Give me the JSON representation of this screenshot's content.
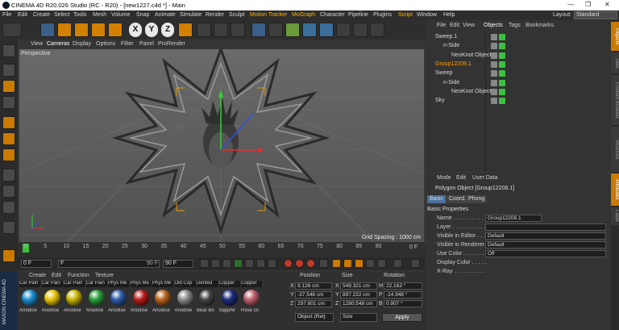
{
  "window": {
    "title": "CINEMA 4D R20.026 Studio (RC - R20) - [new1227.c4d *] - Main",
    "min": "—",
    "max": "❐",
    "close": "✕"
  },
  "menu": [
    "File",
    "Edit",
    "Create",
    "Select",
    "Tools",
    "Mesh",
    "Volume",
    "Snap",
    "Animate",
    "Simulate",
    "Render",
    "Sculpt",
    "Motion Tracker",
    "MoGraph",
    "Character",
    "Pipeline",
    "Plugins",
    "Script",
    "Window",
    "Help"
  ],
  "layout": {
    "label": "Layout:",
    "value": "Standard"
  },
  "toolbar": {
    "axes": [
      "X",
      "Y",
      "Z"
    ]
  },
  "viewport": {
    "menu": [
      "View",
      "Cameras",
      "Display",
      "Options",
      "Filter",
      "Panel",
      "ProRender"
    ],
    "label": "Perspective",
    "grid_spacing": "Grid Spacing : 1000 cm"
  },
  "timeline": {
    "ticks": [
      "0",
      "5",
      "10",
      "15",
      "20",
      "25",
      "30",
      "35",
      "40",
      "45",
      "50",
      "55",
      "60",
      "65",
      "70",
      "75",
      "80",
      "85",
      "90"
    ],
    "end": "0 F",
    "start_field": "0 F",
    "range_start": "F",
    "range_end": "90 F",
    "range_max": "90 F"
  },
  "materials": {
    "menu": [
      "Create",
      "Edit",
      "Function",
      "Texture"
    ],
    "items": [
      {
        "name": "Car Pain",
        "label": "Anodise",
        "color": "#1c8fd0"
      },
      {
        "name": "Car Pain",
        "label": "Anodise",
        "color": "#e8c400"
      },
      {
        "name": "Car Pain",
        "label": "Anodise",
        "color": "#c8b400"
      },
      {
        "name": "Car Pain",
        "label": "Anodise",
        "color": "#2a9d3a"
      },
      {
        "name": "Phys Me",
        "label": "Anodise",
        "color": "#2f5ca8"
      },
      {
        "name": "Phys Me",
        "label": "Anodise",
        "color": "#b71c1c"
      },
      {
        "name": "Phys Me",
        "label": "Anodise",
        "color": "#b8651c"
      },
      {
        "name": "Old Cop",
        "label": "Anodise",
        "color": "#8a8a8a"
      },
      {
        "name": "Dented",
        "label": "Bear Bo",
        "color": "#444444"
      },
      {
        "name": "Copper",
        "label": "Sapphir",
        "color": "#1d2b7a"
      },
      {
        "name": "Copper",
        "label": "Rose Gl",
        "color": "#c06070"
      }
    ]
  },
  "coords": {
    "headers": [
      "Position",
      "Size",
      "Rotation"
    ],
    "rows": [
      {
        "axis": "X",
        "pos": "9.126 cm",
        "size": "549.321 cm",
        "rot_axis": "H",
        "rot": "22.163 °"
      },
      {
        "axis": "Y",
        "pos": "-37.548 cm",
        "size": "897.222 cm",
        "rot_axis": "P",
        "rot": "-14.948 °"
      },
      {
        "axis": "Z",
        "pos": "297.601 cm",
        "size": "1280.548 cm",
        "rot_axis": "B",
        "rot": "0.907 °"
      }
    ],
    "mode1": "Object (Rel)",
    "mode2": "Size",
    "apply": "Apply"
  },
  "objects": {
    "tabs": [
      "File",
      "Edit",
      "View",
      "Objects",
      "Tags",
      "Bookmarks"
    ],
    "items": [
      {
        "name": "Sweep.1",
        "indent": 0,
        "color": "#d8d8d8"
      },
      {
        "name": "n-Side",
        "indent": 1,
        "color": "#d8d8d8"
      },
      {
        "name": "NeoKnot Object",
        "indent": 2,
        "color": "#d8d8d8"
      },
      {
        "name": "Group12208.1",
        "indent": 0,
        "color": "#ffa000"
      },
      {
        "name": "Sweep",
        "indent": 0,
        "color": "#d8d8d8"
      },
      {
        "name": "n-Side",
        "indent": 1,
        "color": "#d8d8d8"
      },
      {
        "name": "NeoKnot Object",
        "indent": 2,
        "color": "#d8d8d8"
      },
      {
        "name": "Sky",
        "indent": 0,
        "color": "#d8d8d8"
      }
    ]
  },
  "attributes": {
    "menu": [
      "Mode",
      "Edit",
      "User Data"
    ],
    "title": "Polygon Object [Group12208.1]",
    "tabs": [
      "Basic",
      "Coord.",
      "Phong"
    ],
    "section": "Basic Properties",
    "rows": [
      {
        "label": "Name . . . . . . . . . . . .",
        "value": "Group12208.1"
      },
      {
        "label": "Layer . . . . . . . . . . . .",
        "value": ""
      },
      {
        "label": "Visible in Editor . . .",
        "value": "Default"
      },
      {
        "label": "Visible in Renderer",
        "value": "Default"
      },
      {
        "label": "Use Color . . . . . . . .",
        "value": "Off"
      },
      {
        "label": "Display Color . . . . .",
        "value": ""
      },
      {
        "label": "X-Ray . . . . . . . . . .",
        "value": ""
      }
    ]
  },
  "right_tabs": [
    "Objects",
    "Take",
    "Content Browser",
    "Structure",
    "Attributes",
    "Layer"
  ],
  "brand": "MAXON CINEMA 4D"
}
